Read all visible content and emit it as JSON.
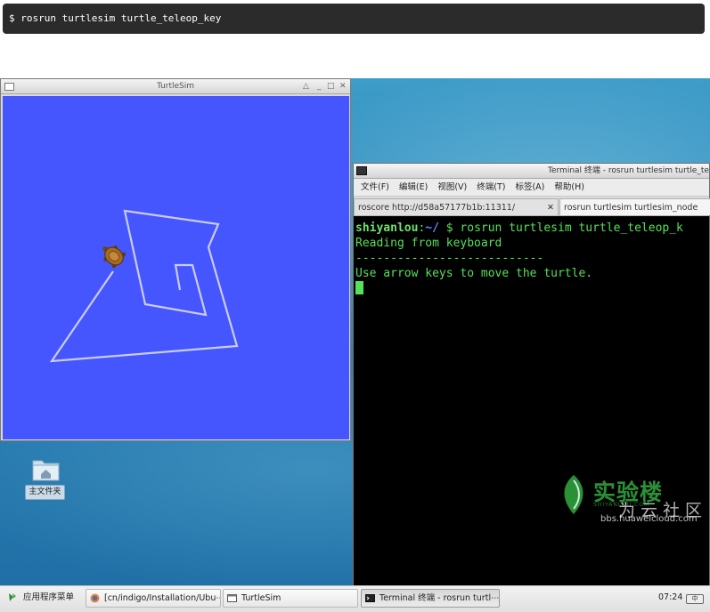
{
  "command": "$ rosrun turtlesim turtle_teleop_key",
  "turtlesim": {
    "title": "TurtleSim",
    "controls": [
      "△",
      "_",
      "□",
      "✕"
    ],
    "background_color": "#4556fe"
  },
  "desktop": {
    "home_label": "主文件夹"
  },
  "terminal": {
    "title": "Terminal 终端 - rosrun turtlesim turtle_te",
    "menu": [
      "文件(F)",
      "编辑(E)",
      "视图(V)",
      "终端(T)",
      "标签(A)",
      "帮助(H)"
    ],
    "tabs": [
      {
        "label": "roscore http://d58a57177b1b:11311/",
        "close": "✕"
      },
      {
        "label": "rosrun turtlesim turtlesim_node"
      }
    ],
    "prompt_user": "shiyanlou",
    "prompt_sep": ":",
    "prompt_path": "~/",
    "prompt_cmd": " $ rosrun turtlesim turtle_teleop_k",
    "lines": [
      "Reading from keyboard",
      "---------------------------",
      "Use arrow keys to move the turtle."
    ]
  },
  "watermark": {
    "brand": "实验楼",
    "sub": "SHIYANLOU.COM",
    "community": "为云社区",
    "url": "bbs.huaweicloud.com"
  },
  "taskbar": {
    "apps_menu": "应用程序菜单",
    "items": [
      "[cn/indigo/Installation/Ubu⋯",
      "TurtleSim",
      "Terminal 终端 - rosrun turtl⋯"
    ],
    "clock": "07:24",
    "keyboard": "中"
  }
}
